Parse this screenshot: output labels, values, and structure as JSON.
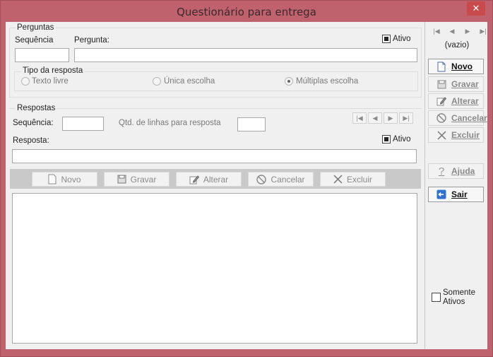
{
  "window": {
    "title": "Questionário para entrega",
    "close_glyph": "✕"
  },
  "perguntas": {
    "legend": "Perguntas",
    "seq_label": "Sequência",
    "seq_value": "",
    "pergunta_label": "Pergunta:",
    "pergunta_value": "",
    "ativo_label": "Ativo",
    "ativo_checked": true,
    "tipo": {
      "legend": "Tipo da resposta",
      "options": [
        {
          "label": "Texto livre",
          "selected": false
        },
        {
          "label": "Única escolha",
          "selected": false
        },
        {
          "label": "Múltiplas escolha",
          "selected": true
        }
      ]
    }
  },
  "respostas": {
    "legend": "Respostas",
    "seq_label": "Sequência:",
    "seq_value": "",
    "qtd_label": "Qtd. de linhas para resposta",
    "qtd_value": "",
    "resposta_label": "Resposta:",
    "resposta_value": "",
    "ativo_label": "Ativo",
    "ativo_checked": true,
    "toolbar": {
      "novo": "Novo",
      "gravar": "Gravar",
      "alterar": "Alterar",
      "cancelar": "Cancelar",
      "excluir": "Excluir"
    }
  },
  "side": {
    "record_label": "(vazio)",
    "novo": "Novo",
    "gravar": "Gravar",
    "alterar": "Alterar",
    "cancelar": "Cancelar",
    "excluir": "Excluir",
    "ajuda": "Ajuda",
    "sair": "Sair",
    "somente_ativos": "Somente Ativos",
    "somente_ativos_checked": false
  },
  "icons": [
    "close-icon",
    "first-icon",
    "prev-icon",
    "next-icon",
    "last-icon",
    "new-document-icon",
    "save-icon",
    "edit-icon",
    "cancel-icon",
    "delete-icon",
    "help-icon",
    "exit-icon"
  ],
  "colors": {
    "title_bar": "#c0616e",
    "client_bg": "#f0f0f0",
    "toolbar_bg": "#c9c9c9"
  }
}
